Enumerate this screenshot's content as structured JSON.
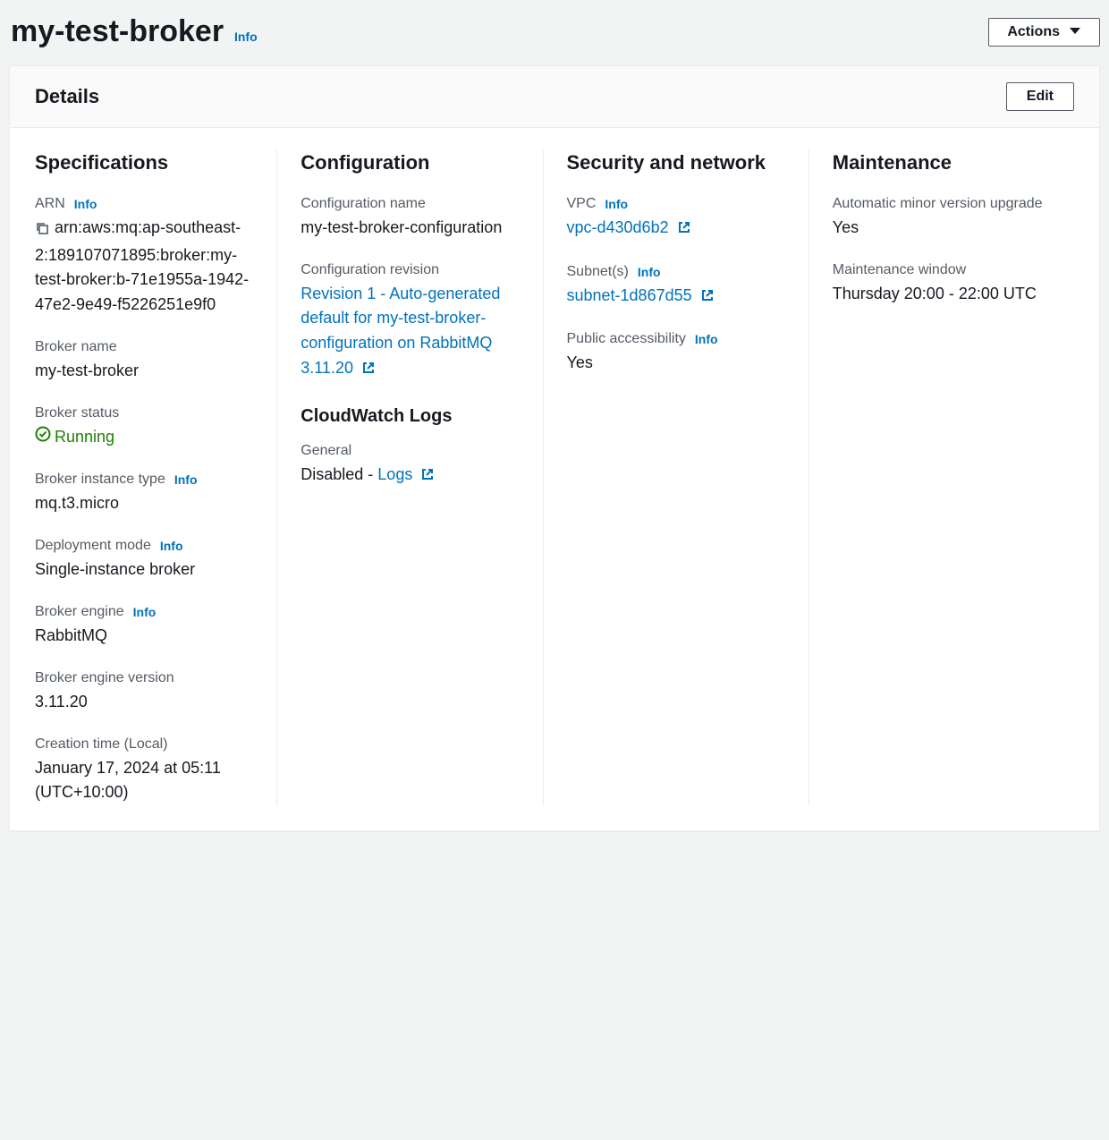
{
  "header": {
    "title": "my-test-broker",
    "info": "Info",
    "actions": "Actions"
  },
  "details": {
    "title": "Details",
    "edit": "Edit"
  },
  "info_label": "Info",
  "spec": {
    "title": "Specifications",
    "arn_label": "ARN",
    "arn": "arn:aws:mq:ap-southeast-2:189107071895:broker:my-test-broker:b-71e1955a-1942-47e2-9e49-f5226251e9f0",
    "broker_name_label": "Broker name",
    "broker_name": "my-test-broker",
    "status_label": "Broker status",
    "status": "Running",
    "instance_type_label": "Broker instance type",
    "instance_type": "mq.t3.micro",
    "deployment_label": "Deployment mode",
    "deployment": "Single-instance broker",
    "engine_label": "Broker engine",
    "engine": "RabbitMQ",
    "engine_version_label": "Broker engine version",
    "engine_version": "3.11.20",
    "creation_label": "Creation time (Local)",
    "creation": "January 17, 2024 at 05:11 (UTC+10:00)"
  },
  "config": {
    "title": "Configuration",
    "name_label": "Configuration name",
    "name": "my-test-broker-configuration",
    "revision_label": "Configuration revision",
    "revision": "Revision 1 - Auto-generated default for my-test-broker-configuration on RabbitMQ 3.11.20",
    "cw_title": "CloudWatch Logs",
    "general_label": "General",
    "general_state": "Disabled - ",
    "general_link": "Logs"
  },
  "security": {
    "title": "Security and network",
    "vpc_label": "VPC",
    "vpc": "vpc-d430d6b2",
    "subnet_label": "Subnet(s)",
    "subnet": "subnet-1d867d55",
    "public_label": "Public accessibility",
    "public": "Yes"
  },
  "maintenance": {
    "title": "Maintenance",
    "auto_label": "Automatic minor version upgrade",
    "auto": "Yes",
    "window_label": "Maintenance window",
    "window": "Thursday 20:00 - 22:00 UTC"
  }
}
